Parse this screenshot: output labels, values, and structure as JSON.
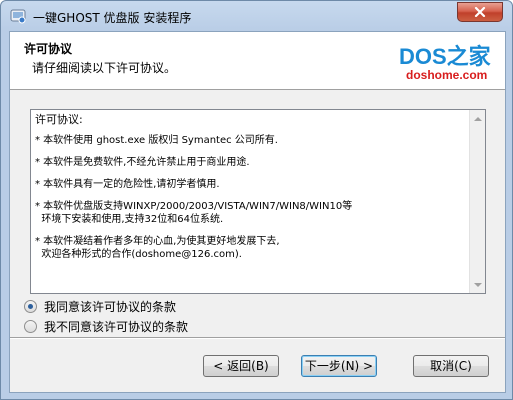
{
  "window": {
    "title": "一键GHOST 优盘版 安装程序",
    "close_symbol": "✕"
  },
  "header": {
    "title": "许可协议",
    "subtitle": "请仔细阅读以下许可协议。",
    "logo_main": "DOS之家",
    "logo_sub": "doshome.com"
  },
  "license": {
    "heading": "许可协议:",
    "items": [
      "* 本软件使用 ghost.exe 版权归 Symantec 公司所有.",
      "* 本软件是免费软件,不经允许禁止用于商业用途.",
      "* 本软件具有一定的危险性,请初学者慎用.",
      "* 本软件优盘版支持WINXP/2000/2003/VISTA/WIN7/WIN8/WIN10等",
      "  环境下安装和使用,支持32位和64位系统.",
      "* 本软件凝结着作者多年的心血,为使其更好地发展下去,",
      "  欢迎各种形式的合作(doshome@126.com)."
    ]
  },
  "options": {
    "agree": "我同意该许可协议的条款",
    "disagree": "我不同意该许可协议的条款",
    "selected": "agree"
  },
  "buttons": {
    "back": "< 返回(B)",
    "next": "下一步(N) >",
    "cancel": "取消(C)"
  },
  "colors": {
    "logo_blue": "#1a8ad4",
    "logo_red": "#d81d1d",
    "radio_dot": "#2c5f9c"
  }
}
